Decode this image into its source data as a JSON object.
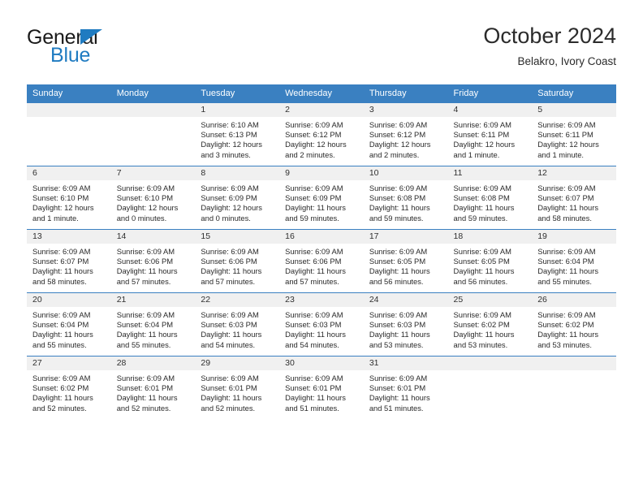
{
  "brand": {
    "name_top": "General",
    "name_bottom": "Blue"
  },
  "header": {
    "title": "October 2024",
    "location": "Belakro, Ivory Coast"
  },
  "colors": {
    "header_blue": "#3a80c1",
    "logo_blue": "#1f7bc1",
    "band_gray": "#f0f0f0"
  },
  "weekday_headers": [
    "Sunday",
    "Monday",
    "Tuesday",
    "Wednesday",
    "Thursday",
    "Friday",
    "Saturday"
  ],
  "labels": {
    "sunrise_prefix": "Sunrise: ",
    "sunset_prefix": "Sunset: ",
    "daylight_prefix": "Daylight: "
  },
  "weeks": [
    [
      {
        "day": "",
        "blank": true
      },
      {
        "day": "",
        "blank": true
      },
      {
        "day": "1",
        "sunrise": "Sunrise: 6:10 AM",
        "sunset": "Sunset: 6:13 PM",
        "daylight": "Daylight: 12 hours and 3 minutes."
      },
      {
        "day": "2",
        "sunrise": "Sunrise: 6:09 AM",
        "sunset": "Sunset: 6:12 PM",
        "daylight": "Daylight: 12 hours and 2 minutes."
      },
      {
        "day": "3",
        "sunrise": "Sunrise: 6:09 AM",
        "sunset": "Sunset: 6:12 PM",
        "daylight": "Daylight: 12 hours and 2 minutes."
      },
      {
        "day": "4",
        "sunrise": "Sunrise: 6:09 AM",
        "sunset": "Sunset: 6:11 PM",
        "daylight": "Daylight: 12 hours and 1 minute."
      },
      {
        "day": "5",
        "sunrise": "Sunrise: 6:09 AM",
        "sunset": "Sunset: 6:11 PM",
        "daylight": "Daylight: 12 hours and 1 minute."
      }
    ],
    [
      {
        "day": "6",
        "sunrise": "Sunrise: 6:09 AM",
        "sunset": "Sunset: 6:10 PM",
        "daylight": "Daylight: 12 hours and 1 minute."
      },
      {
        "day": "7",
        "sunrise": "Sunrise: 6:09 AM",
        "sunset": "Sunset: 6:10 PM",
        "daylight": "Daylight: 12 hours and 0 minutes."
      },
      {
        "day": "8",
        "sunrise": "Sunrise: 6:09 AM",
        "sunset": "Sunset: 6:09 PM",
        "daylight": "Daylight: 12 hours and 0 minutes."
      },
      {
        "day": "9",
        "sunrise": "Sunrise: 6:09 AM",
        "sunset": "Sunset: 6:09 PM",
        "daylight": "Daylight: 11 hours and 59 minutes."
      },
      {
        "day": "10",
        "sunrise": "Sunrise: 6:09 AM",
        "sunset": "Sunset: 6:08 PM",
        "daylight": "Daylight: 11 hours and 59 minutes."
      },
      {
        "day": "11",
        "sunrise": "Sunrise: 6:09 AM",
        "sunset": "Sunset: 6:08 PM",
        "daylight": "Daylight: 11 hours and 59 minutes."
      },
      {
        "day": "12",
        "sunrise": "Sunrise: 6:09 AM",
        "sunset": "Sunset: 6:07 PM",
        "daylight": "Daylight: 11 hours and 58 minutes."
      }
    ],
    [
      {
        "day": "13",
        "sunrise": "Sunrise: 6:09 AM",
        "sunset": "Sunset: 6:07 PM",
        "daylight": "Daylight: 11 hours and 58 minutes."
      },
      {
        "day": "14",
        "sunrise": "Sunrise: 6:09 AM",
        "sunset": "Sunset: 6:06 PM",
        "daylight": "Daylight: 11 hours and 57 minutes."
      },
      {
        "day": "15",
        "sunrise": "Sunrise: 6:09 AM",
        "sunset": "Sunset: 6:06 PM",
        "daylight": "Daylight: 11 hours and 57 minutes."
      },
      {
        "day": "16",
        "sunrise": "Sunrise: 6:09 AM",
        "sunset": "Sunset: 6:06 PM",
        "daylight": "Daylight: 11 hours and 57 minutes."
      },
      {
        "day": "17",
        "sunrise": "Sunrise: 6:09 AM",
        "sunset": "Sunset: 6:05 PM",
        "daylight": "Daylight: 11 hours and 56 minutes."
      },
      {
        "day": "18",
        "sunrise": "Sunrise: 6:09 AM",
        "sunset": "Sunset: 6:05 PM",
        "daylight": "Daylight: 11 hours and 56 minutes."
      },
      {
        "day": "19",
        "sunrise": "Sunrise: 6:09 AM",
        "sunset": "Sunset: 6:04 PM",
        "daylight": "Daylight: 11 hours and 55 minutes."
      }
    ],
    [
      {
        "day": "20",
        "sunrise": "Sunrise: 6:09 AM",
        "sunset": "Sunset: 6:04 PM",
        "daylight": "Daylight: 11 hours and 55 minutes."
      },
      {
        "day": "21",
        "sunrise": "Sunrise: 6:09 AM",
        "sunset": "Sunset: 6:04 PM",
        "daylight": "Daylight: 11 hours and 55 minutes."
      },
      {
        "day": "22",
        "sunrise": "Sunrise: 6:09 AM",
        "sunset": "Sunset: 6:03 PM",
        "daylight": "Daylight: 11 hours and 54 minutes."
      },
      {
        "day": "23",
        "sunrise": "Sunrise: 6:09 AM",
        "sunset": "Sunset: 6:03 PM",
        "daylight": "Daylight: 11 hours and 54 minutes."
      },
      {
        "day": "24",
        "sunrise": "Sunrise: 6:09 AM",
        "sunset": "Sunset: 6:03 PM",
        "daylight": "Daylight: 11 hours and 53 minutes."
      },
      {
        "day": "25",
        "sunrise": "Sunrise: 6:09 AM",
        "sunset": "Sunset: 6:02 PM",
        "daylight": "Daylight: 11 hours and 53 minutes."
      },
      {
        "day": "26",
        "sunrise": "Sunrise: 6:09 AM",
        "sunset": "Sunset: 6:02 PM",
        "daylight": "Daylight: 11 hours and 53 minutes."
      }
    ],
    [
      {
        "day": "27",
        "sunrise": "Sunrise: 6:09 AM",
        "sunset": "Sunset: 6:02 PM",
        "daylight": "Daylight: 11 hours and 52 minutes."
      },
      {
        "day": "28",
        "sunrise": "Sunrise: 6:09 AM",
        "sunset": "Sunset: 6:01 PM",
        "daylight": "Daylight: 11 hours and 52 minutes."
      },
      {
        "day": "29",
        "sunrise": "Sunrise: 6:09 AM",
        "sunset": "Sunset: 6:01 PM",
        "daylight": "Daylight: 11 hours and 52 minutes."
      },
      {
        "day": "30",
        "sunrise": "Sunrise: 6:09 AM",
        "sunset": "Sunset: 6:01 PM",
        "daylight": "Daylight: 11 hours and 51 minutes."
      },
      {
        "day": "31",
        "sunrise": "Sunrise: 6:09 AM",
        "sunset": "Sunset: 6:01 PM",
        "daylight": "Daylight: 11 hours and 51 minutes."
      },
      {
        "day": "",
        "blank": true
      },
      {
        "day": "",
        "blank": true
      }
    ]
  ]
}
